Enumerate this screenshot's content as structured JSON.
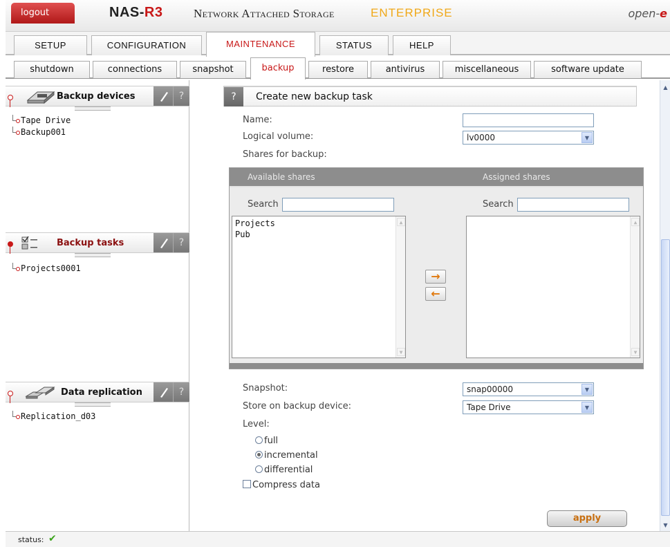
{
  "header": {
    "logout_label": "logout",
    "brand_name": "NAS-",
    "brand_model": "R3",
    "product": "Network Attached Storage",
    "edition": "ENTERPRISE",
    "vendor_prefix": "open-",
    "vendor_suffix": "e"
  },
  "main_tabs": [
    {
      "label": "SETUP",
      "active": false
    },
    {
      "label": "CONFIGURATION",
      "active": false
    },
    {
      "label": "MAINTENANCE",
      "active": true
    },
    {
      "label": "STATUS",
      "active": false
    },
    {
      "label": "HELP",
      "active": false
    }
  ],
  "sub_tabs": [
    {
      "label": "shutdown",
      "active": false
    },
    {
      "label": "connections",
      "active": false
    },
    {
      "label": "snapshot",
      "active": false
    },
    {
      "label": "backup",
      "active": true
    },
    {
      "label": "restore",
      "active": false
    },
    {
      "label": "antivirus",
      "active": false
    },
    {
      "label": "miscellaneous",
      "active": false
    },
    {
      "label": "software update",
      "active": false
    }
  ],
  "left_panels": {
    "backup_devices": {
      "title": "Backup devices",
      "help": "?",
      "items": [
        "Tape Drive",
        "Backup001"
      ]
    },
    "backup_tasks": {
      "title": "Backup tasks",
      "help": "?",
      "items": [
        "Projects0001"
      ]
    },
    "data_replication": {
      "title": "Data replication",
      "help": "?",
      "items": [
        "Replication_d03"
      ]
    }
  },
  "form": {
    "title": "Create new backup task",
    "help": "?",
    "name_label": "Name:",
    "name_value": "",
    "logical_volume_label": "Logical volume:",
    "logical_volume_value": "lv0000",
    "shares_label": "Shares for backup:",
    "available_header": "Available shares",
    "assigned_header": "Assigned shares",
    "search_label_left": "Search",
    "search_label_right": "Search",
    "search_left_value": "",
    "search_right_value": "",
    "available_shares": [
      "Projects",
      "Pub"
    ],
    "assigned_shares": [],
    "add_arrow": "→",
    "remove_arrow": "←",
    "snapshot_label": "Snapshot:",
    "snapshot_value": "snap00000",
    "store_label": "Store on backup device:",
    "store_value": "Tape Drive",
    "level_label": "Level:",
    "levels": [
      {
        "label": "full",
        "checked": false
      },
      {
        "label": "incremental",
        "checked": true
      },
      {
        "label": "differential",
        "checked": false
      }
    ],
    "compress_label": "Compress data",
    "compress_checked": false,
    "apply_label": "apply"
  },
  "status": {
    "label": "status:",
    "icon": "check-icon"
  }
}
